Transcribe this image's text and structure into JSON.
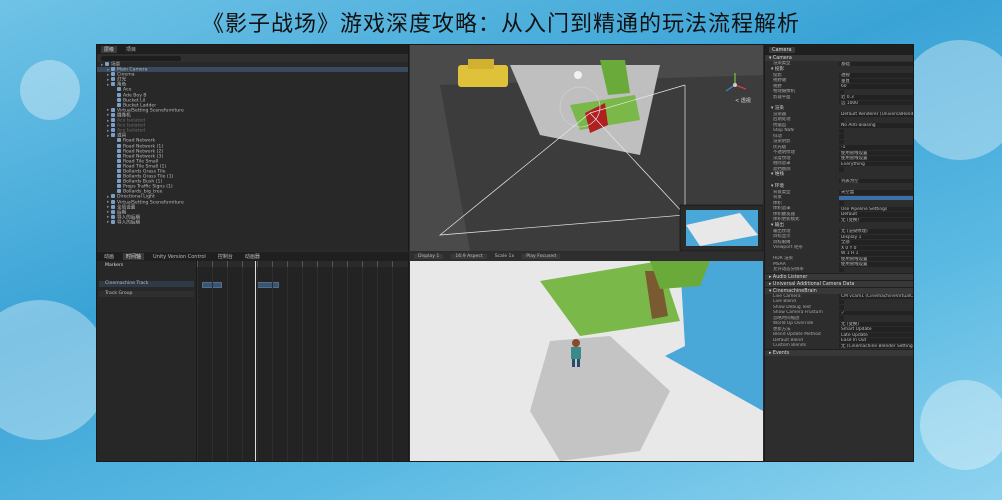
{
  "page_title": "《影子战场》游戏深度攻略：从入门到精通的玩法流程解析",
  "colors": {
    "background": "#4ab0de",
    "editor_bg": "#2b2b2b",
    "selection": "#3a4a5e",
    "sky_blue": "#4aa8d8",
    "ground": "#e6e6e6",
    "grass": "#7bb84a"
  },
  "hierarchy": {
    "tabs": [
      "层级",
      "项目"
    ],
    "rows": [
      {
        "text": "场景",
        "depth": 0,
        "state": "normal"
      },
      {
        "text": "Main Camera",
        "depth": 1,
        "state": "selected"
      },
      {
        "text": "Cinema",
        "depth": 1,
        "state": "normal"
      },
      {
        "text": "灯光",
        "depth": 1,
        "state": "normal"
      },
      {
        "text": "角色",
        "depth": 1,
        "state": "normal"
      },
      {
        "text": "Ace",
        "depth": 2,
        "state": "normal"
      },
      {
        "text": "Ade Boy B",
        "depth": 2,
        "state": "normal"
      },
      {
        "text": "Bucket Lil",
        "depth": 2,
        "state": "normal"
      },
      {
        "text": "Bucket Ladder",
        "depth": 2,
        "state": "normal"
      },
      {
        "text": "VirtualSetting Scenefurniture",
        "depth": 1,
        "state": "normal"
      },
      {
        "text": "摄像机",
        "depth": 1,
        "state": "normal"
      },
      {
        "text": "Ace Isolated",
        "depth": 1,
        "state": "dim"
      },
      {
        "text": "Ace Isolated",
        "depth": 1,
        "state": "dim"
      },
      {
        "text": "Ace Isolated",
        "depth": 1,
        "state": "dim"
      },
      {
        "text": "道具",
        "depth": 1,
        "state": "normal"
      },
      {
        "text": "Road Network",
        "depth": 2,
        "state": "normal"
      },
      {
        "text": "Road Network (1)",
        "depth": 2,
        "state": "normal"
      },
      {
        "text": "Road Network (2)",
        "depth": 2,
        "state": "normal"
      },
      {
        "text": "Road Network (3)",
        "depth": 2,
        "state": "normal"
      },
      {
        "text": "Road Tile Small",
        "depth": 2,
        "state": "normal"
      },
      {
        "text": "Road Tile Small (1)",
        "depth": 2,
        "state": "normal"
      },
      {
        "text": "Bollards Grass Tile",
        "depth": 2,
        "state": "normal"
      },
      {
        "text": "Bollards Grass Tile (1)",
        "depth": 2,
        "state": "normal"
      },
      {
        "text": "Bollards Bush (1)",
        "depth": 2,
        "state": "normal"
      },
      {
        "text": "Props Traffic Signs (1)",
        "depth": 2,
        "state": "normal"
      },
      {
        "text": "Bollards_big_tree",
        "depth": 2,
        "state": "normal"
      },
      {
        "text": "Directional Light",
        "depth": 1,
        "state": "normal"
      },
      {
        "text": "VirtualSetting Scenefurniture",
        "depth": 1,
        "state": "normal"
      },
      {
        "text": "全局设置",
        "depth": 1,
        "state": "normal"
      },
      {
        "text": "后期",
        "depth": 1,
        "state": "normal"
      },
      {
        "text": "导入的后期",
        "depth": 1,
        "state": "normal"
      },
      {
        "text": "导入的后期",
        "depth": 1,
        "state": "normal"
      }
    ]
  },
  "timeline": {
    "tabs": [
      "动画",
      "时间轴",
      "Unity Version Control",
      "控制台",
      "动画器"
    ],
    "track_header": "Markers",
    "tracks": [
      "Cinemachine Track",
      "Track Group"
    ],
    "frame": "0"
  },
  "scene": {
    "gizmo_label": "< 透视"
  },
  "game": {
    "display": "Display 1",
    "aspect": "16:9 Aspect",
    "scale": "Scale 1x",
    "play_focused": "Play Focused"
  },
  "inspector": {
    "object_name": "Camera",
    "rows": [
      {
        "type": "header",
        "text": "▾ Camera"
      },
      {
        "type": "row",
        "k": "渲染类型",
        "v": "基础"
      },
      {
        "type": "section",
        "text": "▾ 投影"
      },
      {
        "type": "row",
        "k": "投影",
        "v": "透视"
      },
      {
        "type": "row",
        "k": "视野轴",
        "v": "垂直"
      },
      {
        "type": "row",
        "k": "视野",
        "v": "60"
      },
      {
        "type": "row",
        "k": "物理摄像机",
        "v": ""
      },
      {
        "type": "row",
        "k": "剪裁平面",
        "v": "近 0.3"
      },
      {
        "type": "row",
        "k": "",
        "v": "远 1000"
      },
      {
        "type": "section",
        "text": "▾ 渲染"
      },
      {
        "type": "row",
        "k": "渲染器",
        "v": "Default Renderer (UniversalRenderPipeline)"
      },
      {
        "type": "row",
        "k": "后期处理",
        "v": ""
      },
      {
        "type": "row",
        "k": "抗锯齿",
        "v": "No Anti-aliasing"
      },
      {
        "type": "row",
        "k": "Stop NaN",
        "v": ""
      },
      {
        "type": "row",
        "k": "抖动",
        "v": ""
      },
      {
        "type": "row",
        "k": "渲染阴影",
        "v": ""
      },
      {
        "type": "row",
        "k": "优先级",
        "v": "-1"
      },
      {
        "type": "row",
        "k": "不透明纹理",
        "v": "使用管线设置"
      },
      {
        "type": "row",
        "k": "深度纹理",
        "v": "使用管线设置"
      },
      {
        "type": "row",
        "k": "剔除遮罩",
        "v": "Everything"
      },
      {
        "type": "row",
        "k": "遮挡剔除",
        "v": ""
      },
      {
        "type": "section",
        "text": "▾ 堆栈"
      },
      {
        "type": "row",
        "k": "",
        "v": "列表为空"
      },
      {
        "type": "section",
        "text": "▾ 环境"
      },
      {
        "type": "row",
        "k": "背景类型",
        "v": "天空盒"
      },
      {
        "type": "row",
        "k": "背景",
        "v": "",
        "blue": true
      },
      {
        "type": "row",
        "k": "体积",
        "v": ""
      },
      {
        "type": "row",
        "k": "体积遮罩",
        "v": "Use Pipeline Settings"
      },
      {
        "type": "row",
        "k": "体积触发器",
        "v": "Default"
      },
      {
        "type": "row",
        "k": "体积更新模式",
        "v": "无 (变换)"
      },
      {
        "type": "section",
        "text": "▾ 输出"
      },
      {
        "type": "row",
        "k": "输出纹理",
        "v": "无 (渲染纹理)"
      },
      {
        "type": "row",
        "k": "目标显示",
        "v": "Display 1"
      },
      {
        "type": "row",
        "k": "目标眼睛",
        "v": "全部"
      },
      {
        "type": "row",
        "k": "Viewport 矩形",
        "v": "X 0   Y 0"
      },
      {
        "type": "row",
        "k": "",
        "v": "W 1   H 1"
      },
      {
        "type": "row",
        "k": "HDR 渲染",
        "v": "使用管线设置"
      },
      {
        "type": "row",
        "k": "MSAA",
        "v": "使用管线设置"
      },
      {
        "type": "row",
        "k": "允许动态分辨率",
        "v": ""
      },
      {
        "type": "header",
        "text": "▸ Audio Listener"
      },
      {
        "type": "header",
        "text": "▸ Universal Additional Camera Data"
      },
      {
        "type": "header",
        "text": "▾ CinemachineBrain"
      },
      {
        "type": "row",
        "k": "Live Camera",
        "v": "CM vcam1 (CinemachineVirtualCamera)"
      },
      {
        "type": "row",
        "k": "Live Blend",
        "v": ""
      },
      {
        "type": "row",
        "k": "Show Debug Text",
        "v": ""
      },
      {
        "type": "row",
        "k": "Show Camera Frustum",
        "v": "✓"
      },
      {
        "type": "row",
        "k": "忽略时间缩放",
        "v": ""
      },
      {
        "type": "row",
        "k": "World Up Override",
        "v": "无 (变换)"
      },
      {
        "type": "row",
        "k": "更新方法",
        "v": "Smart Update"
      },
      {
        "type": "row",
        "k": "Blend Update Method",
        "v": "Late Update"
      },
      {
        "type": "row",
        "k": "Default Blend",
        "v": "Ease In Out"
      },
      {
        "type": "row",
        "k": "Custom Blends",
        "v": "无 (Cinemachine Blender Settings)"
      },
      {
        "type": "header",
        "text": "▸ Events"
      }
    ]
  }
}
